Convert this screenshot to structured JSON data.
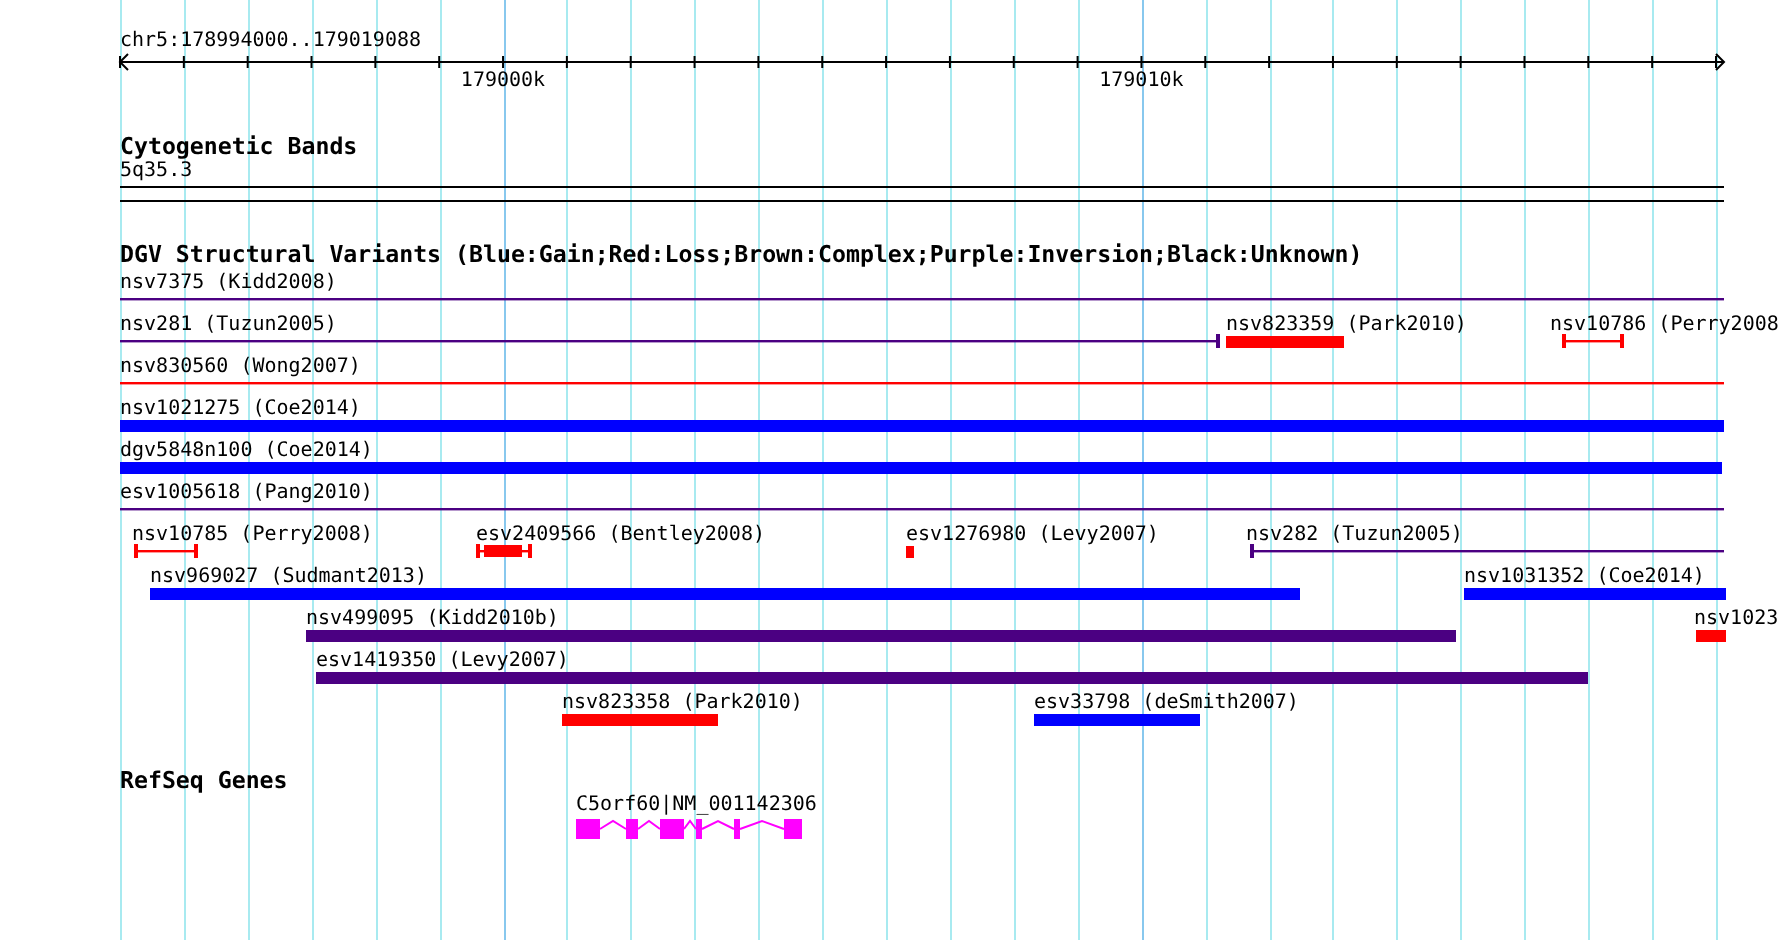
{
  "ruler": {
    "title": "chr5:178994000..179019088",
    "ticks": [
      "179000k",
      "179010k"
    ]
  },
  "cytoband_track": {
    "title": "Cytogenetic Bands",
    "band": "5q35.3"
  },
  "variant_track": {
    "title": "DGV Structural Variants (Blue:Gain;Red:Loss;Brown:Complex;Purple:Inversion;Black:Unknown)",
    "rows": [
      {
        "features": [
          {
            "label": "nsv7375 (Kidd2008)",
            "color": "#4b0082",
            "kind": "line"
          }
        ]
      },
      {
        "features": [
          {
            "label": "nsv281 (Tuzun2005)",
            "color": "#4b0082",
            "kind": "line"
          },
          {
            "label": "nsv823359 (Park2010)",
            "color": "#ff0000",
            "kind": "bar"
          },
          {
            "label": "nsv10786 (Perry2008",
            "color": "#ff0000",
            "kind": "line"
          }
        ]
      },
      {
        "features": [
          {
            "label": "nsv830560 (Wong2007)",
            "color": "#ff0000",
            "kind": "line"
          }
        ]
      },
      {
        "features": [
          {
            "label": "nsv1021275 (Coe2014)",
            "color": "#0000ff",
            "kind": "bar"
          }
        ]
      },
      {
        "features": [
          {
            "label": "dgv5848n100 (Coe2014)",
            "color": "#0000ff",
            "kind": "bar"
          }
        ]
      },
      {
        "features": [
          {
            "label": "esv1005618 (Pang2010)",
            "color": "#4b0082",
            "kind": "line"
          }
        ]
      },
      {
        "features": [
          {
            "label": "nsv10785 (Perry2008)",
            "color": "#ff0000",
            "kind": "line"
          },
          {
            "label": "esv2409566 (Bentley2008)",
            "color": "#ff0000",
            "kind": "capped-bar"
          },
          {
            "label": "esv1276980 (Levy2007)",
            "color": "#ff0000",
            "kind": "bar"
          },
          {
            "label": "nsv282 (Tuzun2005)",
            "color": "#4b0082",
            "kind": "line"
          }
        ]
      },
      {
        "features": [
          {
            "label": "nsv969027 (Sudmant2013)",
            "color": "#0000ff",
            "kind": "bar"
          },
          {
            "label": "nsv1031352 (Coe2014)",
            "color": "#0000ff",
            "kind": "bar"
          }
        ]
      },
      {
        "features": [
          {
            "label": "nsv499095 (Kidd2010b)",
            "color": "#4b0082",
            "kind": "bar"
          },
          {
            "label": "nsv1023",
            "color": "#ff0000",
            "kind": "bar"
          }
        ]
      },
      {
        "features": [
          {
            "label": "esv1419350 (Levy2007)",
            "color": "#4b0082",
            "kind": "bar"
          }
        ]
      },
      {
        "features": [
          {
            "label": "nsv823358 (Park2010)",
            "color": "#ff0000",
            "kind": "bar"
          },
          {
            "label": "esv33798 (deSmith2007)",
            "color": "#0000ff",
            "kind": "bar"
          }
        ]
      }
    ]
  },
  "gene_track": {
    "title": "RefSeq Genes",
    "genes": [
      {
        "label": "C5orf60|NM_001142306",
        "color": "#ff00ff"
      }
    ]
  }
}
